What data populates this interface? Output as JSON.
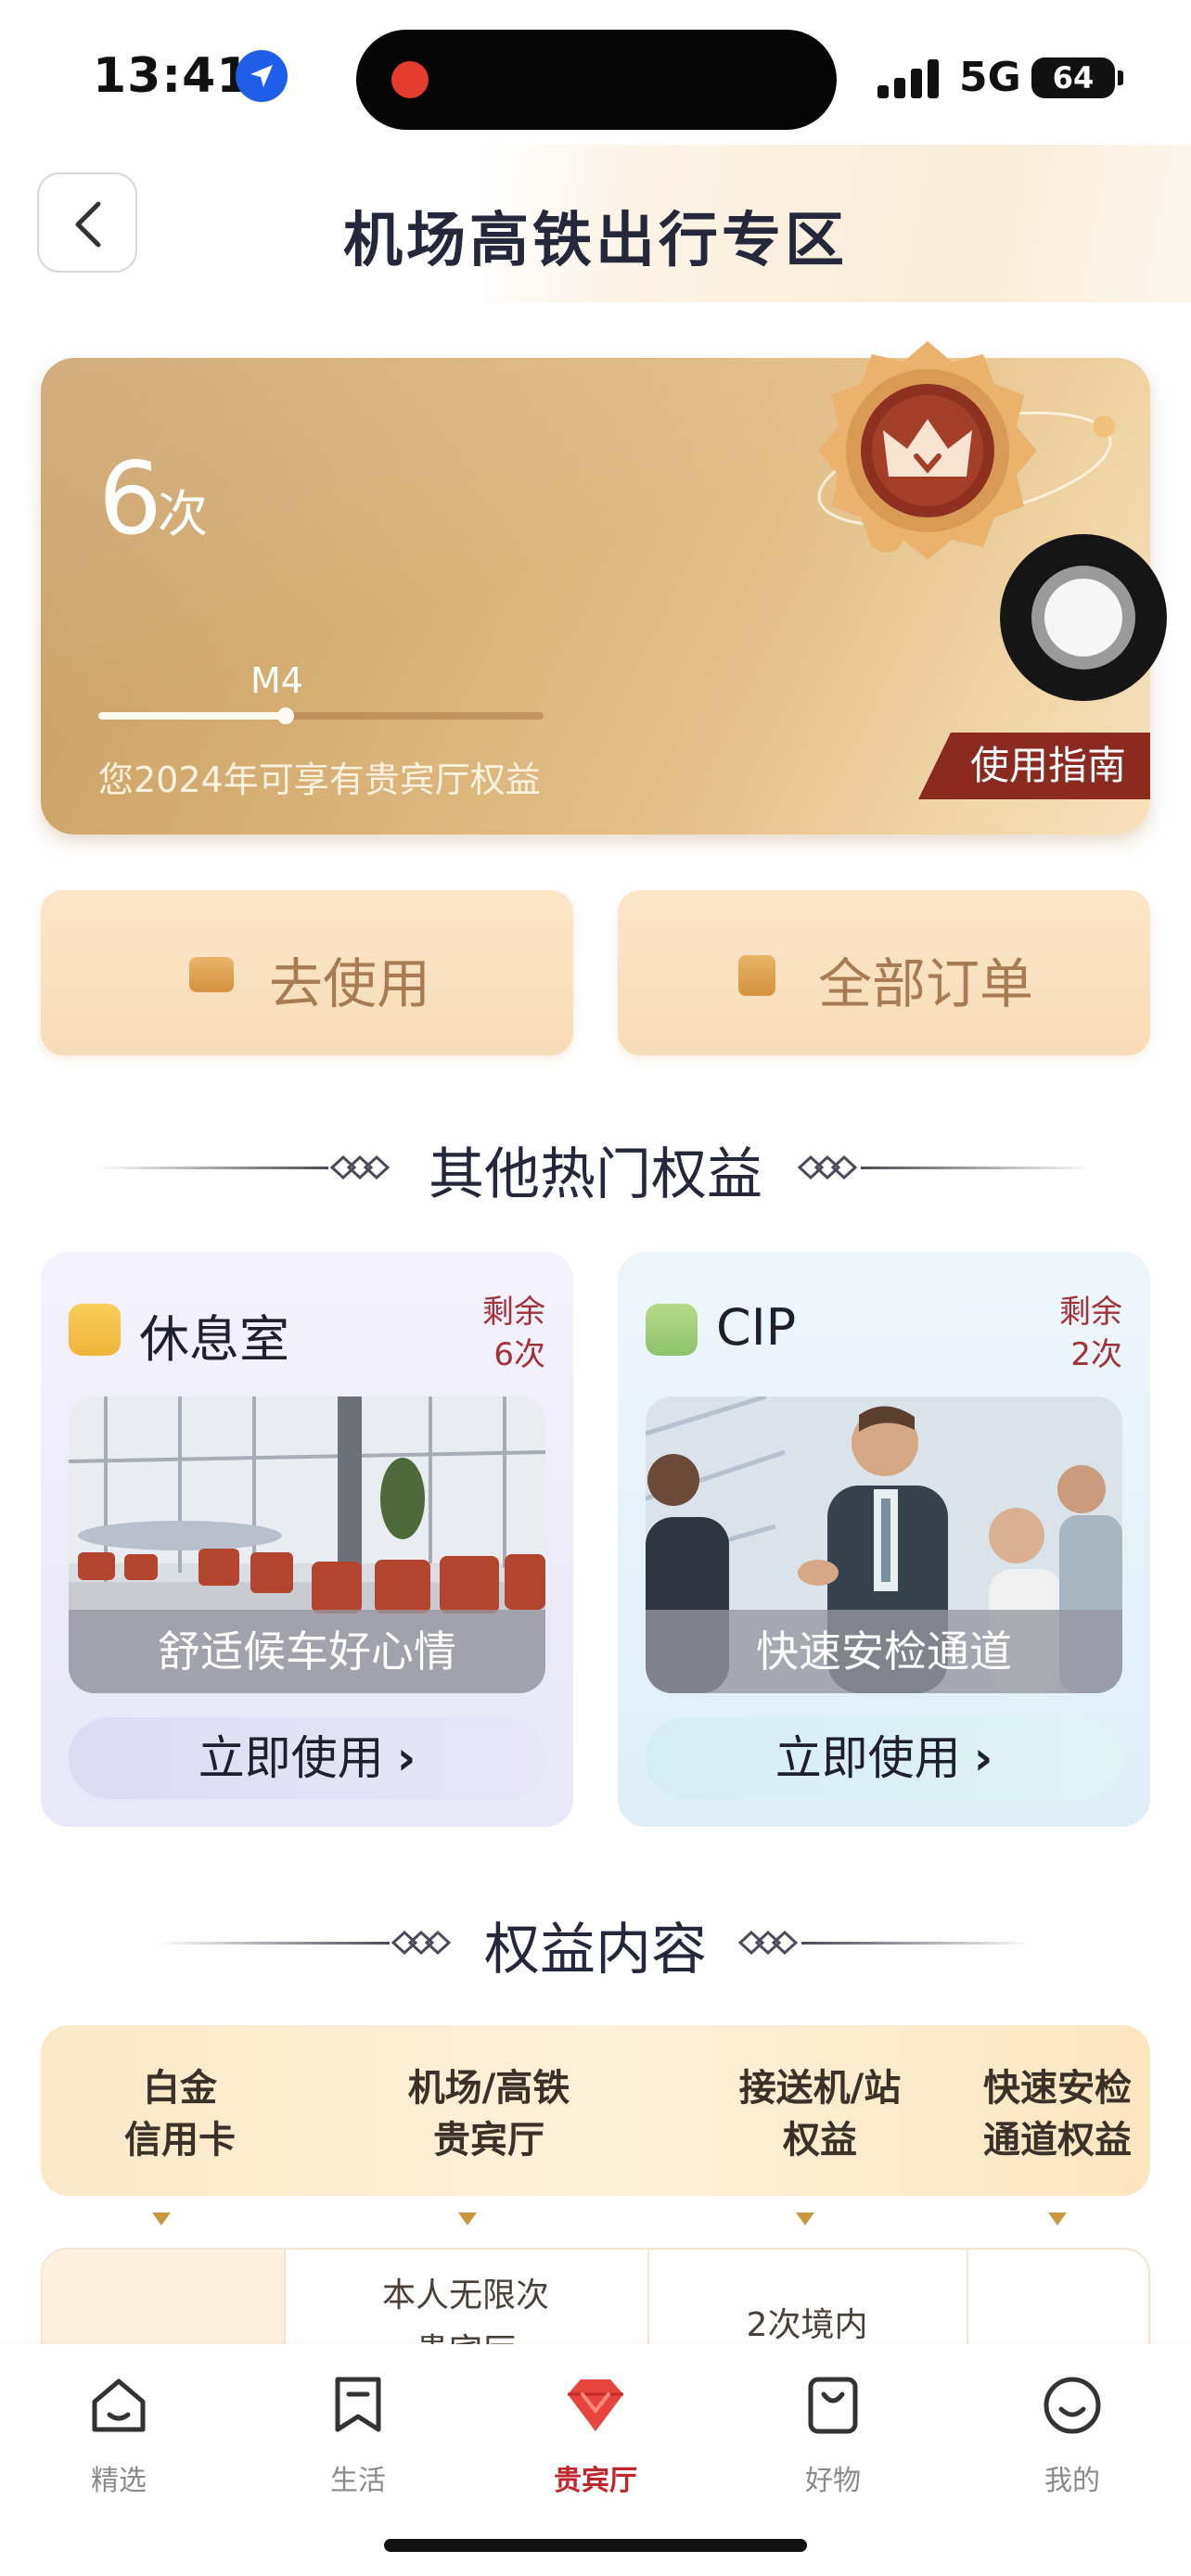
{
  "status_bar": {
    "time": "13:41",
    "network": "5G",
    "battery": "64"
  },
  "header": {
    "title": "机场高铁出行专区"
  },
  "gold_card": {
    "count_value": "6",
    "count_unit": "次",
    "level": "M4",
    "level_progress": 0.42,
    "subtitle": "您2024年可享有贵宾厅权益",
    "guide_label": "使用指南",
    "colors": {
      "accent": "#8b2a1f",
      "gold": "#d6ad73"
    }
  },
  "actions": [
    {
      "label": "去使用",
      "icon": "ticket-icon"
    },
    {
      "label": "全部订单",
      "icon": "order-list-icon"
    }
  ],
  "section_other": {
    "title": "其他热门权益"
  },
  "benefits": [
    {
      "name": "休息室",
      "icon": "lounge-icon",
      "remain_label": "剩余",
      "remain_count": "6次",
      "caption": "舒适候车好心情",
      "button": "立即使用",
      "photo": "airport-lounge-photo"
    },
    {
      "name": "CIP",
      "icon": "cip-icon",
      "remain_label": "剩余",
      "remain_count": "2次",
      "caption": "快速安检通道",
      "button": "立即使用",
      "photo": "business-handshake-photo"
    }
  ],
  "section_content": {
    "title": "权益内容"
  },
  "table": {
    "headers": [
      {
        "line1": "白金",
        "line2": "信用卡"
      },
      {
        "line1": "机场/高铁",
        "line2": "贵宾厅"
      },
      {
        "line1": "接送机/站",
        "line2": "权益"
      },
      {
        "line1": "快速安检",
        "line2": "通道权益"
      }
    ],
    "row1": {
      "c2_line1": "本人无限次",
      "c2_line2": "贵宾厅",
      "c3_line1": "2次境内"
    }
  },
  "tab_bar": {
    "items": [
      {
        "label": "精选",
        "icon": "home-icon"
      },
      {
        "label": "生活",
        "icon": "bookmark-icon"
      },
      {
        "label": "贵宾厅",
        "icon": "diamond-icon",
        "active": true
      },
      {
        "label": "好物",
        "icon": "shopping-bag-icon"
      },
      {
        "label": "我的",
        "icon": "smiley-icon"
      }
    ]
  }
}
